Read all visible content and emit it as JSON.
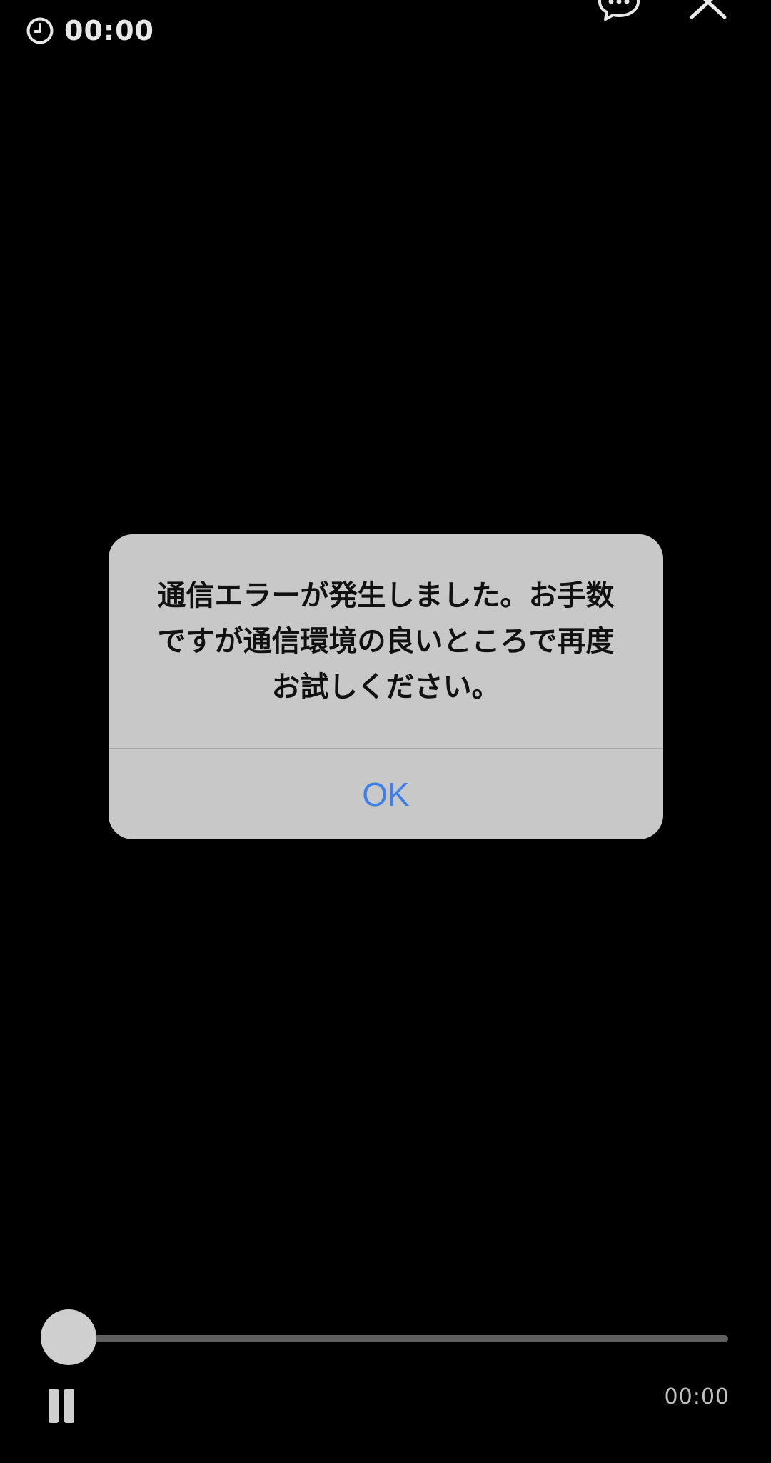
{
  "player": {
    "elapsed_time": "00:00",
    "duration_time": "00:00",
    "progress": 0,
    "icons": {
      "clock": "clock-icon",
      "chat": "chat-bubble-icon",
      "close": "close-icon",
      "pause": "pause-icon"
    }
  },
  "dialog": {
    "message": "通信エラーが発生しました。お手数ですが通信環境の良いところで再度お試しください。",
    "ok_label": "OK"
  },
  "colors": {
    "background": "#000000",
    "dialog_bg": "#c8c8c8",
    "accent": "#3f7fe6",
    "control": "#cfcfcf"
  }
}
